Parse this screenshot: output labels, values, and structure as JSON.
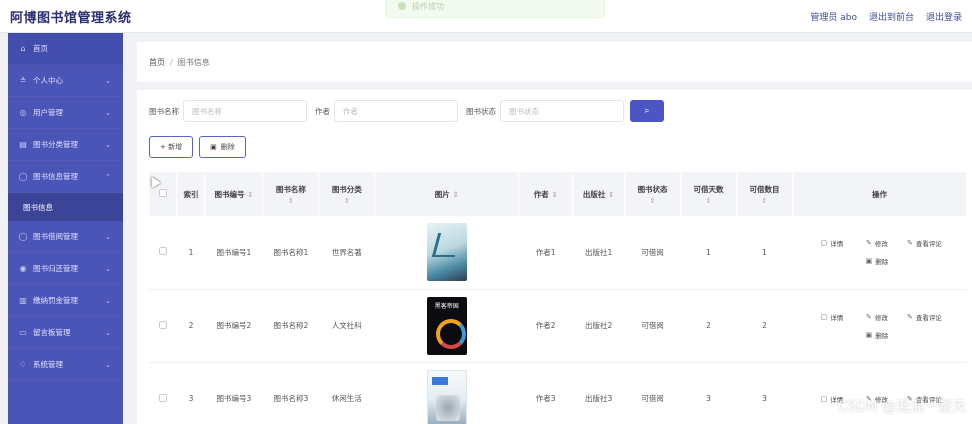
{
  "app": {
    "title": "阿博图书馆管理系统"
  },
  "toast": {
    "text": "操作成功"
  },
  "topbar": {
    "admin": "管理员 abo",
    "back_front": "退出到前台",
    "logout": "退出登录"
  },
  "sidebar": {
    "items": [
      {
        "label": "首页",
        "icon": "home-icon",
        "glyph": "⌂",
        "has_chevron": false
      },
      {
        "label": "个人中心",
        "icon": "user-icon",
        "glyph": "≗",
        "has_chevron": true
      },
      {
        "label": "用户管理",
        "icon": "users-icon",
        "glyph": "◎",
        "has_chevron": true
      },
      {
        "label": "图书分类管理",
        "icon": "category-icon",
        "glyph": "▤",
        "has_chevron": true
      },
      {
        "label": "图书信息管理",
        "icon": "book-icon",
        "glyph": "◯",
        "has_chevron": true,
        "expanded": true,
        "sub": "图书信息"
      },
      {
        "label": "图书借阅管理",
        "icon": "borrow-icon",
        "glyph": "◯",
        "has_chevron": true
      },
      {
        "label": "图书归还管理",
        "icon": "return-icon",
        "glyph": "◉",
        "has_chevron": true
      },
      {
        "label": "缴纳罚金管理",
        "icon": "fine-icon",
        "glyph": "▥",
        "has_chevron": true
      },
      {
        "label": "留言板管理",
        "icon": "message-icon",
        "glyph": "▭",
        "has_chevron": true
      },
      {
        "label": "系统管理",
        "icon": "system-icon",
        "glyph": "♢",
        "has_chevron": true
      }
    ]
  },
  "breadcrumb": {
    "home": "首页",
    "sep": "/",
    "current": "图书信息"
  },
  "search": {
    "name_label": "图书名称",
    "name_placeholder": "图书名称",
    "author_label": "作者",
    "author_placeholder": "作者",
    "status_label": "图书状态",
    "status_placeholder": "图书状态",
    "button_glyph": "⌕"
  },
  "actions": {
    "add": "+ 新增",
    "delete": "删除",
    "delete_glyph": "🗑"
  },
  "table": {
    "headers": [
      "索引",
      "图书编号",
      "图书名称",
      "图书分类",
      "图片",
      "作者",
      "出版社",
      "图书状态",
      "可借天数",
      "可借数目",
      "操作"
    ],
    "rows": [
      {
        "index": "1",
        "code": "图书编号1",
        "name": "图书名称1",
        "category": "世界名著",
        "author": "作者1",
        "publisher": "出版社1",
        "status": "可借阅",
        "days": "1",
        "count": "1",
        "cover_title": ""
      },
      {
        "index": "2",
        "code": "图书编号2",
        "name": "图书名称2",
        "category": "人文社科",
        "author": "作者2",
        "publisher": "出版社2",
        "status": "可借阅",
        "days": "2",
        "count": "2",
        "cover_title": "黑客帝国"
      },
      {
        "index": "3",
        "code": "图书编号3",
        "name": "图书名称3",
        "category": "休闲生活",
        "author": "作者3",
        "publisher": "出版社3",
        "status": "可借阅",
        "days": "3",
        "count": "3",
        "cover_title": ""
      }
    ],
    "ops": {
      "detail": "详情",
      "edit": "修改",
      "review": "查看评论",
      "delete": "删除"
    }
  },
  "watermark": "CSDN @混混一整天"
}
